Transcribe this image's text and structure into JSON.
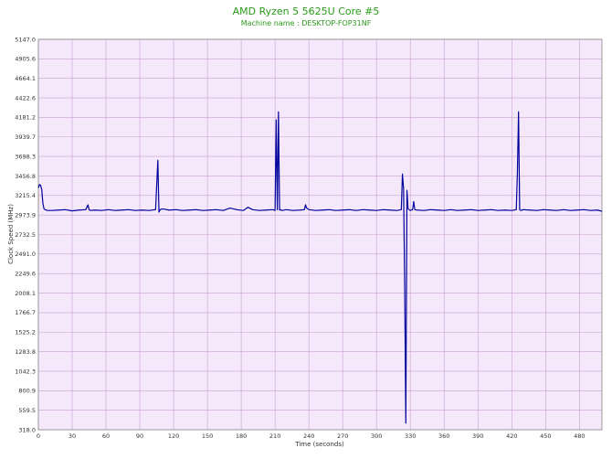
{
  "chart_data": {
    "type": "line",
    "title": "AMD Ryzen 5 5625U Core #5",
    "subtitle": "Machine name : DESKTOP-FOP31NF",
    "xlabel": "Time (seconds)",
    "ylabel": "Clock Speed (MHz)",
    "xlim": [
      0,
      500
    ],
    "ylim": [
      318.0,
      5147.0
    ],
    "x_ticks": [
      0,
      30,
      60,
      90,
      120,
      150,
      180,
      210,
      240,
      270,
      300,
      330,
      360,
      390,
      420,
      450,
      480
    ],
    "y_ticks": [
      318.0,
      559.5,
      800.9,
      1042.3,
      1283.8,
      1525.2,
      1766.7,
      2008.1,
      2249.6,
      2491.0,
      2732.5,
      2973.9,
      3215.4,
      3456.8,
      3698.3,
      3939.7,
      4181.2,
      4422.6,
      4664.1,
      4905.6,
      5147.0
    ],
    "grid": true,
    "colors": {
      "line": "#00009c",
      "plot_background": "#f5e8fb",
      "grid": "#c9a0d0",
      "title": "#2a9a1a"
    },
    "series": [
      {
        "x": [
          0,
          1,
          2,
          3,
          4,
          5,
          6,
          8,
          12,
          18,
          24,
          30,
          36,
          42,
          44,
          45,
          46,
          50,
          56,
          62,
          68,
          74,
          80,
          86,
          92,
          98,
          104,
          106,
          107,
          108,
          110,
          116,
          122,
          128,
          134,
          140,
          146,
          152,
          158,
          164,
          170,
          176,
          182,
          186,
          190,
          196,
          202,
          208,
          210,
          211,
          212,
          213,
          214,
          215,
          216,
          220,
          226,
          232,
          236,
          237,
          238,
          240,
          246,
          252,
          258,
          264,
          270,
          276,
          282,
          288,
          294,
          300,
          306,
          312,
          318,
          322,
          323,
          324,
          325,
          326,
          327,
          328,
          329,
          330,
          332,
          333,
          334,
          336,
          342,
          348,
          354,
          360,
          366,
          372,
          378,
          384,
          390,
          396,
          402,
          408,
          414,
          420,
          424,
          425,
          426,
          427,
          428,
          430,
          436,
          442,
          448,
          454,
          460,
          466,
          472,
          478,
          484,
          490,
          496,
          500
        ],
        "y": [
          3310,
          3350,
          3340,
          3290,
          3120,
          3050,
          3040,
          3030,
          3030,
          3035,
          3040,
          3025,
          3035,
          3040,
          3100,
          3040,
          3030,
          3035,
          3030,
          3040,
          3030,
          3035,
          3040,
          3030,
          3035,
          3030,
          3040,
          3650,
          3010,
          3040,
          3050,
          3035,
          3040,
          3030,
          3035,
          3040,
          3030,
          3035,
          3040,
          3030,
          3060,
          3040,
          3030,
          3070,
          3040,
          3030,
          3035,
          3040,
          3030,
          4150,
          3040,
          4250,
          3035,
          3040,
          3030,
          3040,
          3030,
          3035,
          3040,
          3100,
          3060,
          3040,
          3030,
          3035,
          3040,
          3030,
          3035,
          3040,
          3030,
          3040,
          3035,
          3030,
          3040,
          3035,
          3030,
          3040,
          3480,
          3300,
          2080,
          400,
          3280,
          3050,
          3040,
          3030,
          3040,
          3140,
          3040,
          3035,
          3030,
          3040,
          3035,
          3030,
          3040,
          3030,
          3035,
          3040,
          3030,
          3035,
          3040,
          3030,
          3035,
          3030,
          3040,
          3500,
          4250,
          3040,
          3030,
          3040,
          3035,
          3030,
          3040,
          3035,
          3030,
          3040,
          3030,
          3035,
          3040,
          3030,
          3035,
          3020
        ]
      }
    ]
  }
}
